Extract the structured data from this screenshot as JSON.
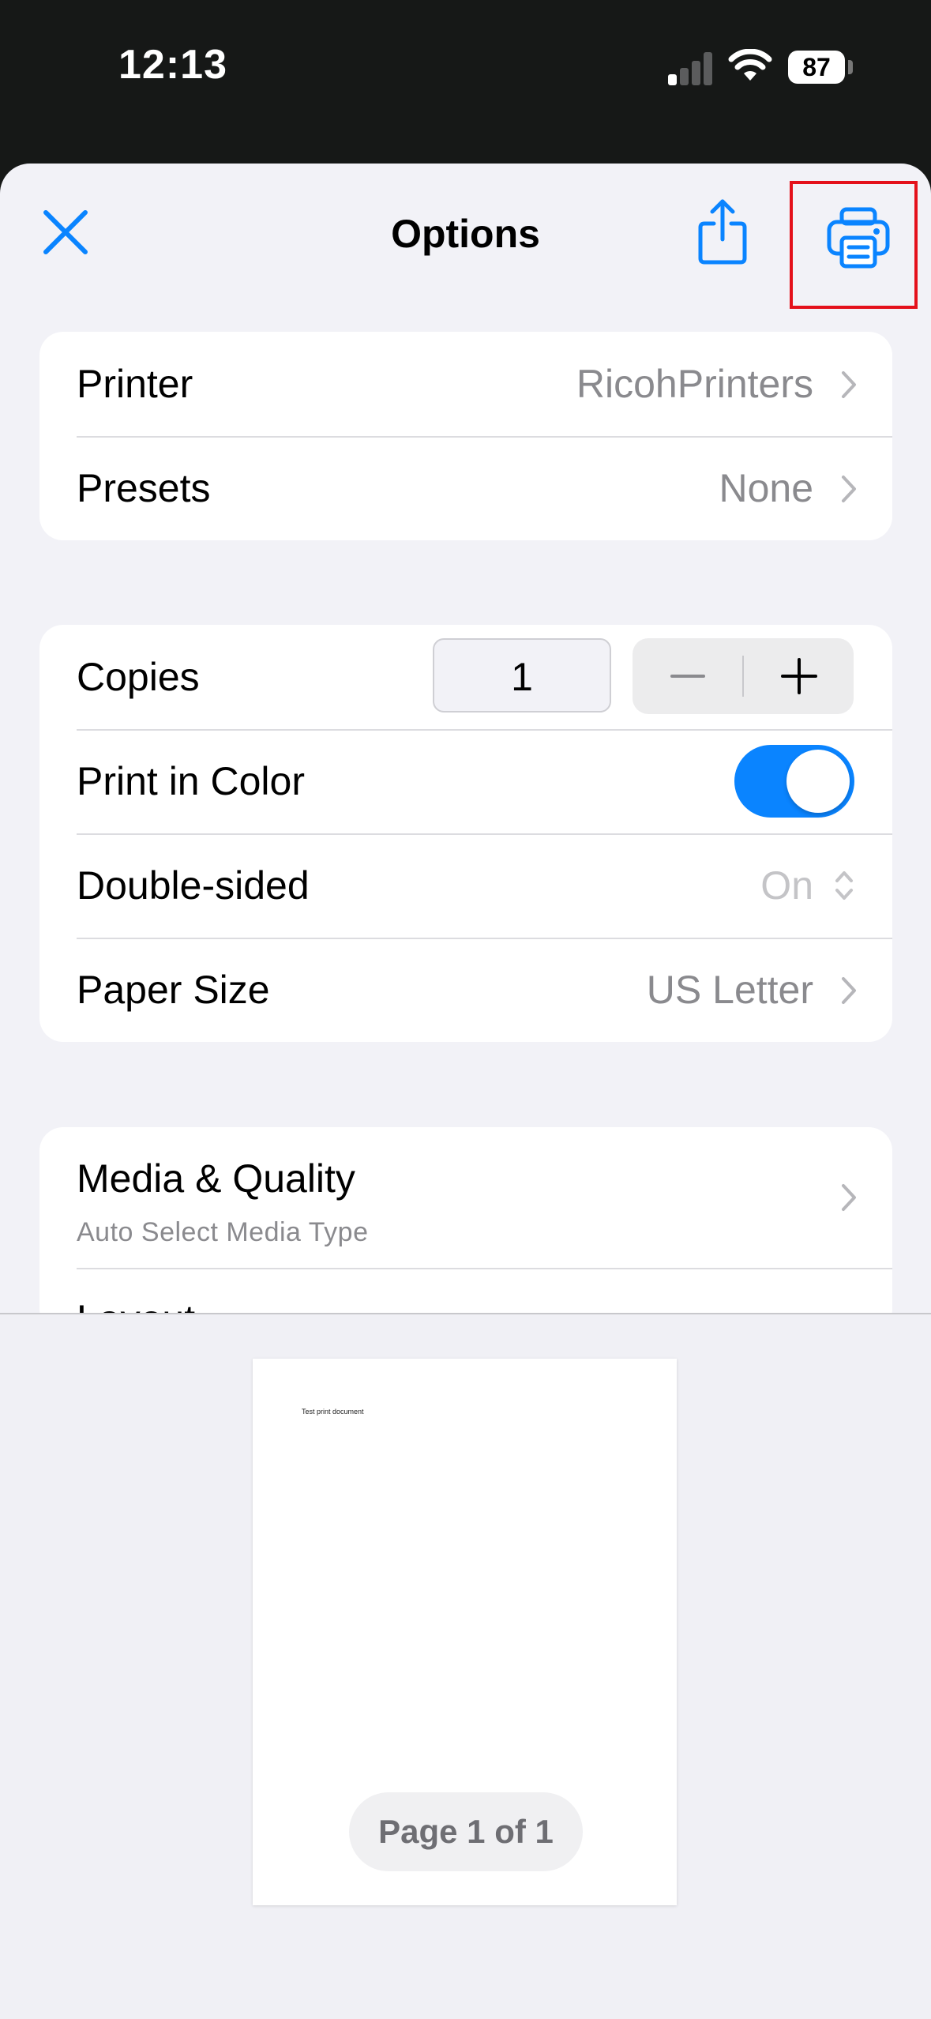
{
  "status_bar": {
    "time": "12:13",
    "battery": "87"
  },
  "sheet": {
    "title": "Options",
    "close_icon": "close-icon",
    "share_icon": "share-icon",
    "print_icon": "printer-icon"
  },
  "printer_group": {
    "printer": {
      "label": "Printer",
      "value": "RicohPrinters"
    },
    "presets": {
      "label": "Presets",
      "value": "None"
    }
  },
  "settings_group": {
    "copies": {
      "label": "Copies",
      "value": "1",
      "minus": "—",
      "plus": "+"
    },
    "color": {
      "label": "Print in Color",
      "on": true
    },
    "double_sided": {
      "label": "Double-sided",
      "value": "On"
    },
    "paper_size": {
      "label": "Paper Size",
      "value": "US Letter"
    }
  },
  "media_group": {
    "media_quality": {
      "label": "Media & Quality",
      "subtitle": "Auto Select Media Type"
    },
    "layout": {
      "label": "Layout"
    }
  },
  "preview": {
    "document_text": "Test print document",
    "page_indicator": "Page 1 of 1"
  },
  "colors": {
    "accent": "#0A84FF",
    "highlight": "#E4111B"
  }
}
